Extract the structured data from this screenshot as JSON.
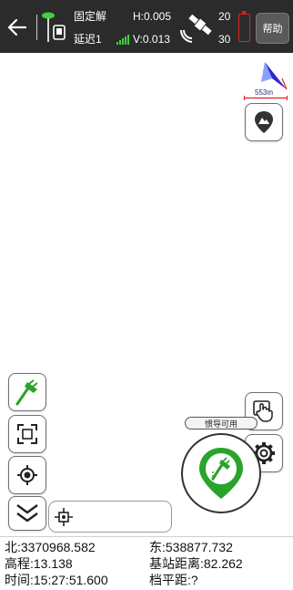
{
  "status_bar": {
    "solution_type": "固定解",
    "latency": "延迟1",
    "h_precision": "H:0.005",
    "v_precision": "V:0.013",
    "satellites_used": "20",
    "satellites_tracked": "30",
    "help_label": "帮助",
    "icons": {
      "back": "back-arrow-icon",
      "rover": "gnss-rover-icon",
      "signal": "signal-bars-icon",
      "satellite": "satellite-icon",
      "battery": "battery-icon"
    },
    "colors": {
      "bar_bg": "#2b2b2b",
      "signal": "#3fd13f",
      "battery": "#e02020"
    }
  },
  "map": {
    "scale_label": "553m",
    "inertial_badge": "惯导可用",
    "buttons": {
      "layers": "map-layers-icon",
      "stakeout": "stakeout-pole-icon",
      "fullscreen": "fullscreen-frame-icon",
      "locate": "locate-target-icon",
      "collapse": "double-chevron-down-icon",
      "hand": "hand-touch-icon",
      "settings": "gear-icon",
      "survey": "survey-point-icon",
      "coord": "crosshair-icon"
    },
    "colors": {
      "accent_green": "#2aa32a"
    }
  },
  "info": {
    "north": "北:3370968.582",
    "east": "东:538877.732",
    "elevation": "高程:13.138",
    "base_distance": "基站距离:82.262",
    "time": "时间:15:27:51.600",
    "bar_distance": "档平距:?"
  }
}
